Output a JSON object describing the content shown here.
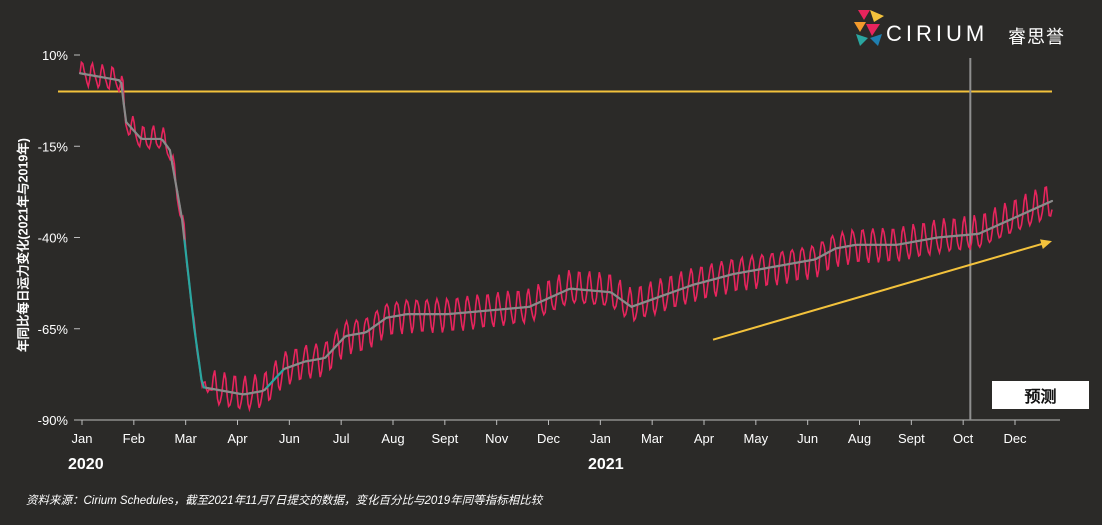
{
  "logo": {
    "brand": "CIRIUM",
    "brand_cn": "睿思誉"
  },
  "ylabel_text": "年同比每日运力变化(2021年与2019年)",
  "year_labels": [
    "2020",
    "2021"
  ],
  "source": "资料来源：Cirium Schedules，截至2021年11月7日提交的数据，变化百分比与2019年同等指标相比较",
  "forecast_label": "预测",
  "colors": {
    "background": "#2b2a28",
    "daily_line": "#e8245d",
    "average_line": "#8a8a8a",
    "average_line_drop": "#2aa6a0",
    "reference_line": "#f3c23c",
    "trend_arrow": "#f3c23c",
    "forecast_line": "#8f8f8f"
  },
  "chart_data": {
    "type": "line",
    "ylabel": "年同比每日运力变化(2021年与2019年)",
    "xlabel": "",
    "ylim": [
      -90,
      10
    ],
    "y_ticks": [
      "10%",
      "-15%",
      "-40%",
      "-65%",
      "-90%"
    ],
    "x_tick_labels": [
      "Jan",
      "Feb",
      "Mar",
      "Apr",
      "Jun",
      "Jul",
      "Aug",
      "Sept",
      "Nov",
      "Dec",
      "Jan",
      "Mar",
      "Apr",
      "May",
      "Jun",
      "Aug",
      "Sept",
      "Oct",
      "Dec"
    ],
    "x_month_range": [
      0,
      23.8
    ],
    "reference_line_value": 0,
    "forecast_start_month": 21.8,
    "trend_arrow": {
      "from": [
        15.5,
        -68
      ],
      "to": [
        23.8,
        -41
      ]
    },
    "series": [
      {
        "key": "avg",
        "months": [
          0,
          0.5,
          1.0,
          1.05,
          1.1,
          1.5,
          2.0,
          2.2,
          2.5,
          2.8,
          3.0,
          3.5,
          4.0,
          4.5,
          5.0,
          5.5,
          6.0,
          6.5,
          7.0,
          7.5,
          8.0,
          9.0,
          10.0,
          11.0,
          12.0,
          13.0,
          13.5,
          14.0,
          15.0,
          16.0,
          17.0,
          18.0,
          18.5,
          19.0,
          20.0,
          21.0,
          22.0,
          23.0,
          23.8
        ],
        "values": [
          5,
          4,
          3,
          0,
          -8,
          -13,
          -13,
          -16,
          -35,
          -65,
          -81,
          -82,
          -83,
          -82,
          -76,
          -74,
          -73,
          -67,
          -66,
          -62,
          -61,
          -61,
          -60,
          -59,
          -54,
          -55,
          -59,
          -57,
          -53,
          -50,
          -48,
          -46,
          -43,
          -42,
          -42,
          -40,
          -39,
          -34,
          -30
        ]
      }
    ]
  }
}
